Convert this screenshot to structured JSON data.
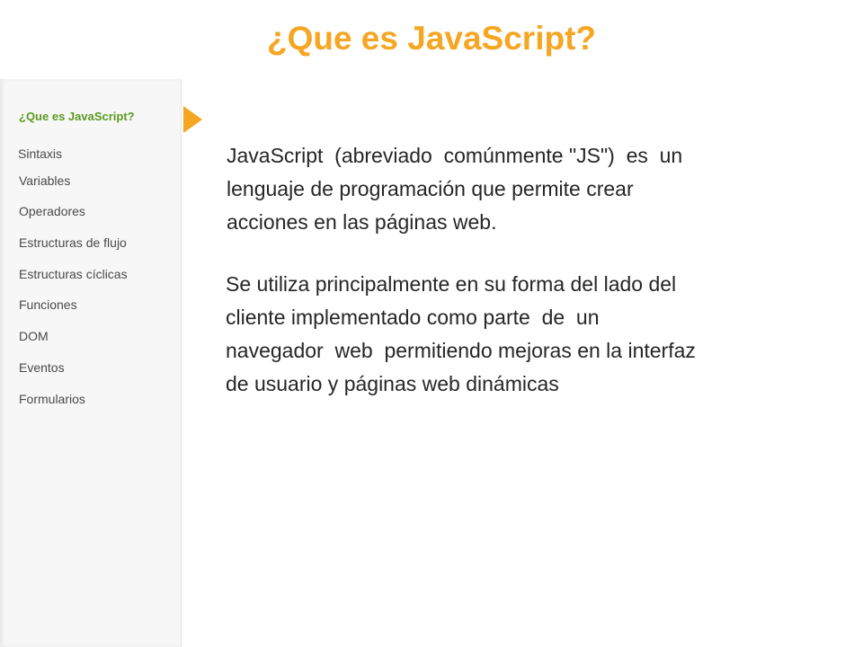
{
  "slide": {
    "title": "¿Que es JavaScript?"
  },
  "sidebar": {
    "items": [
      {
        "label": "¿Que es JavaScript?",
        "active": true
      },
      {
        "label": "Sintaxis",
        "active": false
      },
      {
        "label": "Variables",
        "active": false
      },
      {
        "label": "Operadores",
        "active": false
      },
      {
        "label": "Estructuras de flujo",
        "active": false
      },
      {
        "label": "Estructuras cíclicas",
        "active": false
      },
      {
        "label": "Funciones",
        "active": false
      },
      {
        "label": "DOM",
        "active": false
      },
      {
        "label": "Eventos",
        "active": false
      },
      {
        "label": "Formularios",
        "active": false
      }
    ]
  },
  "content": {
    "paragraph_1": {
      "lines": [
        "JavaScript  (abreviado  comúnmente \"JS\")  es  un",
        "lenguaje de programación que permite crear",
        "acciones en las páginas web."
      ]
    },
    "paragraph_2": {
      "lines": [
        "Se utiliza principalmente en su forma del lado del",
        "cliente implementado como parte  de  un",
        "navegador  web  permitiendo mejoras en la interfaz",
        "de usuario y páginas web dinámicas"
      ]
    }
  },
  "colors": {
    "accent": "#F5A623",
    "active_item": "#5B9A1E",
    "body_text": "#262626"
  },
  "icons": {
    "pointer": "triangle-right-icon"
  }
}
